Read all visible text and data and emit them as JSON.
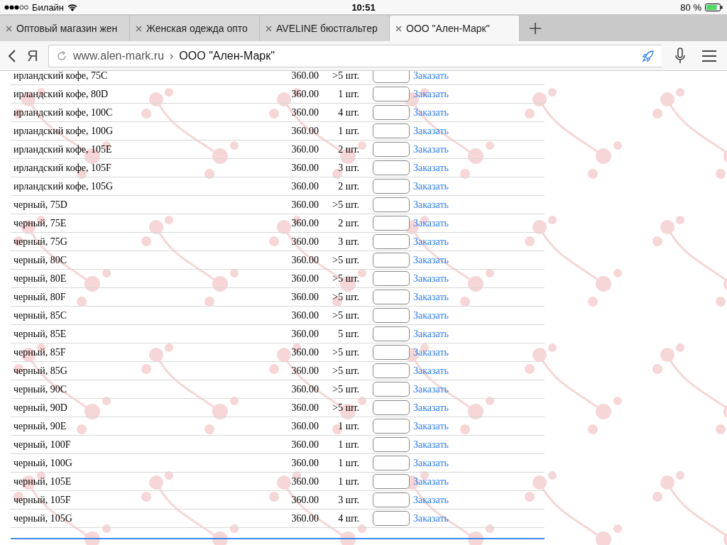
{
  "status_bar": {
    "carrier": "Билайн",
    "time": "10:51",
    "battery": "80 %"
  },
  "tabs": [
    {
      "label": "Оптовый магазин жен",
      "selected": false
    },
    {
      "label": "Женская одежда опто",
      "selected": false
    },
    {
      "label": "AVELINE бюстгальтер",
      "selected": false
    },
    {
      "label": "ООО \"Ален-Марк\"",
      "selected": true
    }
  ],
  "address_bar": {
    "yandex_button": "Я",
    "domain": "www.alen-mark.ru",
    "separator": "›",
    "page_title": "ООО \"Ален-Марк\""
  },
  "table": {
    "rows": [
      {
        "name": "ирландский кофе, 75C",
        "price": "360.00",
        "stock": ">5 шт.",
        "order": "Заказать"
      },
      {
        "name": "ирландский кофе, 80D",
        "price": "360.00",
        "stock": "1 шт.",
        "order": "Заказать"
      },
      {
        "name": "ирландский кофе, 100C",
        "price": "360.00",
        "stock": "4 шт.",
        "order": "Заказать"
      },
      {
        "name": "ирландский кофе, 100G",
        "price": "360.00",
        "stock": "1 шт.",
        "order": "Заказать"
      },
      {
        "name": "ирландский кофе, 105E",
        "price": "360.00",
        "stock": "2 шт.",
        "order": "Заказать"
      },
      {
        "name": "ирландский кофе, 105F",
        "price": "360.00",
        "stock": "3 шт.",
        "order": "Заказать"
      },
      {
        "name": "ирландский кофе, 105G",
        "price": "360.00",
        "stock": "2 шт.",
        "order": "Заказать"
      },
      {
        "name": "черный, 75D",
        "price": "360.00",
        "stock": ">5 шт.",
        "order": "Заказать"
      },
      {
        "name": "черный, 75E",
        "price": "360.00",
        "stock": "2 шт.",
        "order": "Заказать"
      },
      {
        "name": "черный, 75G",
        "price": "360.00",
        "stock": "3 шт.",
        "order": "Заказать"
      },
      {
        "name": "черный, 80C",
        "price": "360.00",
        "stock": ">5 шт.",
        "order": "Заказать"
      },
      {
        "name": "черный, 80E",
        "price": "360.00",
        "stock": ">5 шт.",
        "order": "Заказать"
      },
      {
        "name": "черный, 80F",
        "price": "360.00",
        "stock": ">5 шт.",
        "order": "Заказать"
      },
      {
        "name": "черный, 85C",
        "price": "360.00",
        "stock": ">5 шт.",
        "order": "Заказать"
      },
      {
        "name": "черный, 85E",
        "price": "360.00",
        "stock": "5 шт.",
        "order": "Заказать"
      },
      {
        "name": "черный, 85F",
        "price": "360.00",
        "stock": ">5 шт.",
        "order": "Заказать"
      },
      {
        "name": "черный, 85G",
        "price": "360.00",
        "stock": ">5 шт.",
        "order": "Заказать"
      },
      {
        "name": "черный, 90C",
        "price": "360.00",
        "stock": ">5 шт.",
        "order": "Заказать"
      },
      {
        "name": "черный, 90D",
        "price": "360.00",
        "stock": ">5 шт.",
        "order": "Заказать"
      },
      {
        "name": "черный, 90E",
        "price": "360.00",
        "stock": "1 шт.",
        "order": "Заказать"
      },
      {
        "name": "черный, 100F",
        "price": "360.00",
        "stock": "1 шт.",
        "order": "Заказать"
      },
      {
        "name": "черный, 100G",
        "price": "360.00",
        "stock": "1 шт.",
        "order": "Заказать"
      },
      {
        "name": "черный, 105E",
        "price": "360.00",
        "stock": "1 шт.",
        "order": "Заказать"
      },
      {
        "name": "черный, 105F",
        "price": "360.00",
        "stock": "3 шт.",
        "order": "Заказать"
      },
      {
        "name": "черный, 105G",
        "price": "360.00",
        "stock": "4 шт.",
        "order": "Заказать"
      }
    ]
  }
}
